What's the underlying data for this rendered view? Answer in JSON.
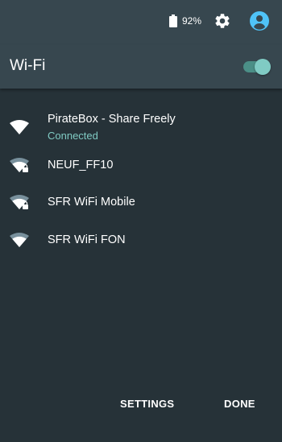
{
  "status_bar": {
    "battery_percent": "92%",
    "icons": [
      "battery-icon",
      "gear-icon",
      "account-icon"
    ]
  },
  "header": {
    "title": "Wi-Fi",
    "toggle_on": true
  },
  "networks": [
    {
      "name": "PirateBox - Share Freely",
      "status": "Connected",
      "secured": false
    },
    {
      "name": "NEUF_FF10",
      "secured": true
    },
    {
      "name": "SFR WiFi Mobile",
      "secured": true
    },
    {
      "name": "SFR WiFi FON",
      "secured": false
    }
  ],
  "footer": {
    "settings_label": "SETTINGS",
    "done_label": "DONE"
  },
  "colors": {
    "background": "#263238",
    "header": "#37474f",
    "accent": "#80cbc4",
    "account": "#4fc3f7"
  }
}
